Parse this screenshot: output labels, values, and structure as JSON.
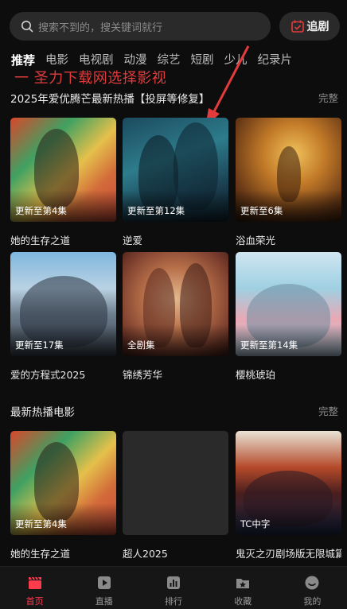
{
  "search": {
    "placeholder": "搜索不到的，搜关键词就行"
  },
  "follow_button": {
    "label": "追剧"
  },
  "tabs": [
    "推荐",
    "电影",
    "电视剧",
    "动漫",
    "综艺",
    "短剧",
    "少儿",
    "纪录片"
  ],
  "promo_text": "一 圣力下载网选择影视",
  "sections": [
    {
      "title": "2025年爱优腾芒最新热播【投屏等修复】",
      "more": "完整",
      "items": [
        {
          "title": "她的生存之道",
          "badge": "更新至第4集"
        },
        {
          "title": "逆爱",
          "badge": "更新至第12集"
        },
        {
          "title": "浴血荣光",
          "badge": "更新至6集"
        },
        {
          "title": "爱的方程式2025",
          "badge": "更新至17集"
        },
        {
          "title": "锦绣芳华",
          "badge": "全剧集"
        },
        {
          "title": "樱桃琥珀",
          "badge": "更新至第14集"
        }
      ]
    },
    {
      "title": "最新热播电影",
      "more": "完整",
      "items": [
        {
          "title": "她的生存之道",
          "badge": "更新至第4集"
        },
        {
          "title": "超人2025",
          "badge": ""
        },
        {
          "title": "鬼灭之刃剧场版无限城篇",
          "badge": "TC中字"
        }
      ]
    }
  ],
  "bottom_nav": [
    {
      "label": "首页",
      "icon": "clapperboard-icon",
      "active": true
    },
    {
      "label": "直播",
      "icon": "play-icon",
      "active": false
    },
    {
      "label": "排行",
      "icon": "chart-icon",
      "active": false
    },
    {
      "label": "收藏",
      "icon": "star-folder-icon",
      "active": false
    },
    {
      "label": "我的",
      "icon": "smile-icon",
      "active": false
    }
  ],
  "colors": {
    "accent": "#ff3b4e",
    "promo": "#e23b3b",
    "background": "#0d0d0d"
  }
}
